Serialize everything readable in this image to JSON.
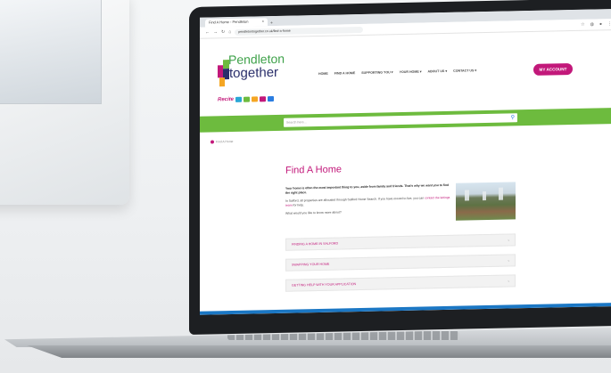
{
  "browser": {
    "tab_title": "Find A Home - Pendleton",
    "tab_close": "×",
    "tab_new": "+",
    "url": "pendletontogether.co.uk/find-a-home",
    "back_icon": "arrow-left-icon",
    "forward_icon": "arrow-right-icon",
    "reload_icon": "reload-icon",
    "home_icon": "home-icon"
  },
  "site": {
    "logo_top": "Pendleton",
    "logo_bottom": "together",
    "menu": [
      "HOME",
      "FIND A HOME",
      "SUPPORTING YOU ▾",
      "YOUR HOME ▾",
      "ABOUT US ▾",
      "CONTACT US ▾"
    ],
    "account_button": "MY ACCOUNT",
    "recite_label": "Recite",
    "search_placeholder": "Search here...",
    "breadcrumb": "Find A Home",
    "brand_pink": "#c2187a",
    "brand_green": "#6dbb3e"
  },
  "main": {
    "title": "Find A Home",
    "intro": "Your home is often the most important thing to you, aside from family and friends. That's why we want you to find the right place.",
    "para2_a": "In Salford, all properties are allocated through Salford Home Search. If you have moved to live, you can",
    "para2_link": "contact the lettings team",
    "para2_b": "for help.",
    "question": "What would you like to know more about?",
    "accordion": [
      "FINDING A HOME IN SALFORD",
      "SWAPPING YOUR HOME",
      "GETTING HELP WITH YOUR APPLICATION"
    ]
  }
}
